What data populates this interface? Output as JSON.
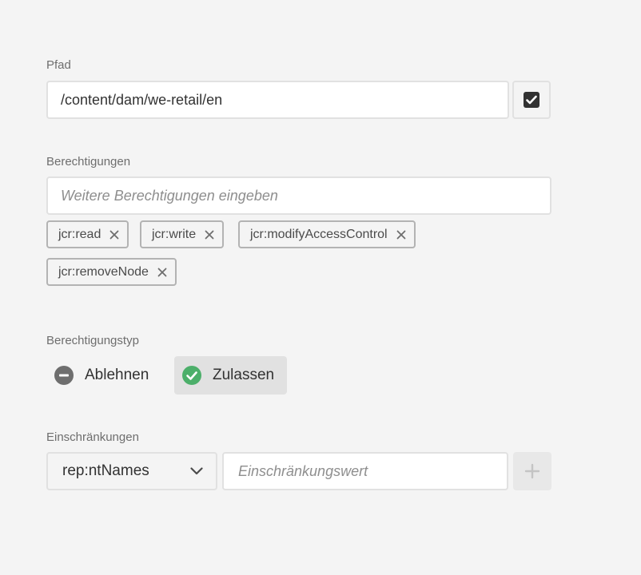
{
  "path": {
    "label": "Pfad",
    "value": "/content/dam/we-retail/en",
    "checkbox_icon": "checkbox-checked-icon"
  },
  "permissions": {
    "label": "Berechtigungen",
    "placeholder": "Weitere Berechtigungen eingeben",
    "tags": [
      {
        "text": "jcr:read"
      },
      {
        "text": "jcr:write"
      },
      {
        "text": "jcr:modifyAccessControl"
      },
      {
        "text": "jcr:removeNode"
      }
    ]
  },
  "permission_type": {
    "label": "Berechtigungstyp",
    "deny_label": "Ablehnen",
    "allow_label": "Zulassen",
    "selected": "Zulassen",
    "allow_color": "#2d9d78",
    "deny_color": "#6e6e6e"
  },
  "restrictions": {
    "label": "Einschränkungen",
    "selected_type": "rep:ntNames",
    "value_placeholder": "Einschränkungswert",
    "add_icon": "plus-icon"
  }
}
